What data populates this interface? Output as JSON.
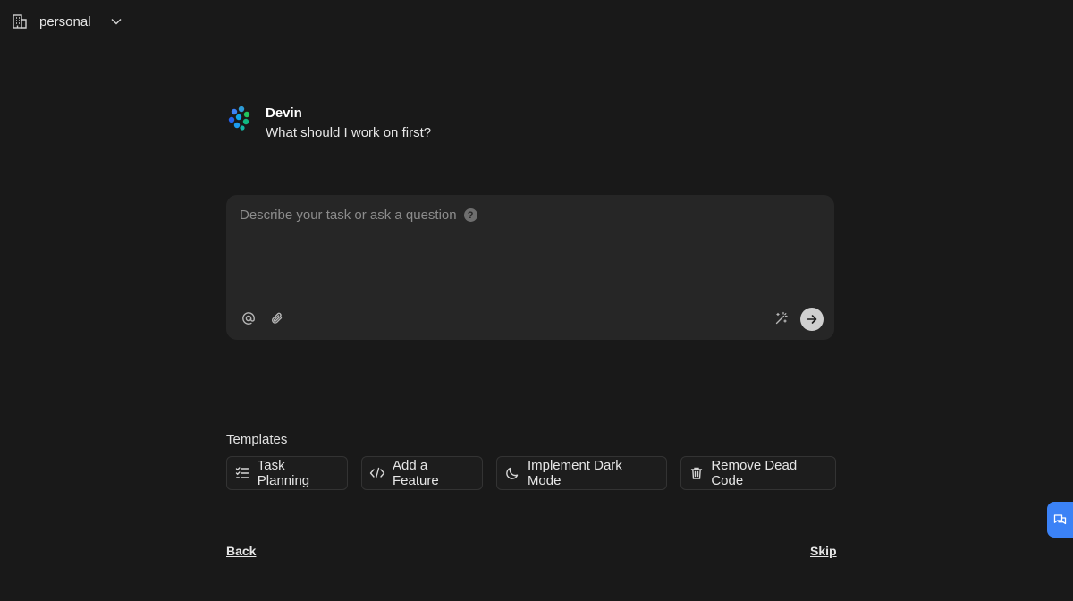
{
  "workspace": {
    "label": "personal",
    "icon": "building-icon"
  },
  "agent": {
    "name": "Devin",
    "question": "What should I work on first?",
    "logo": "devin-logo"
  },
  "composer": {
    "placeholder": "Describe your task or ask a question",
    "help_icon_text": "?",
    "tools": [
      "at-icon",
      "paperclip-icon",
      "magic-wand-icon",
      "send-arrow-icon"
    ]
  },
  "templates": {
    "title": "Templates",
    "items": [
      {
        "label": "Task Planning",
        "icon": "checklist-icon"
      },
      {
        "label": "Add a Feature",
        "icon": "code-icon"
      },
      {
        "label": "Implement Dark Mode",
        "icon": "moon-icon"
      },
      {
        "label": "Remove Dead Code",
        "icon": "trash-icon"
      }
    ]
  },
  "footer": {
    "back_label": "Back",
    "skip_label": "Skip"
  },
  "colors": {
    "background": "#191919",
    "composer": "#262626",
    "feedback": "#3b82f6"
  }
}
